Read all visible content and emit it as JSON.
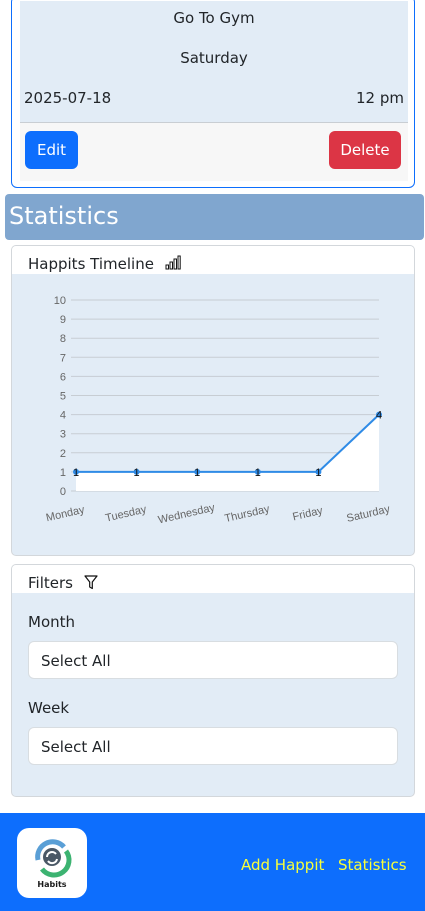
{
  "habit": {
    "title": "Go To Gym",
    "day": "Saturday",
    "date": "2025-07-18",
    "time": "12 pm",
    "edit_label": "Edit",
    "delete_label": "Delete"
  },
  "statistics": {
    "heading": "Statistics"
  },
  "timeline": {
    "title": "Happits Timeline",
    "icon": "bar-chart-icon"
  },
  "chart_data": {
    "type": "line",
    "categories": [
      "Monday",
      "Tuesday",
      "Wednesday",
      "Thursday",
      "Friday",
      "Saturday"
    ],
    "series": [
      {
        "values": [
          1,
          1,
          1,
          1,
          1,
          4
        ]
      }
    ],
    "data_labels": [
      "1",
      "1",
      "1",
      "1",
      "1",
      "4"
    ],
    "ylim": [
      0,
      10
    ],
    "yticks": [
      "0",
      "1",
      "2",
      "3",
      "4",
      "5",
      "6",
      "7",
      "8",
      "9",
      "10"
    ],
    "grid": true,
    "line_color": "#2f8be6",
    "fill_color": "#ffffff"
  },
  "filters": {
    "title": "Filters",
    "icon": "funnel-icon",
    "month_label": "Month",
    "month_value": "Select All",
    "week_label": "Week",
    "week_value": "Select All"
  },
  "nav": {
    "logo_text": "Habits",
    "add_link": "Add Happit",
    "stats_link": "Statistics"
  },
  "colors": {
    "primary": "#0d6efd",
    "danger": "#dc3545",
    "stats_header": "#80a6cf",
    "card_bg": "#e2ecf6",
    "nav_link": "#f8ff3a"
  }
}
